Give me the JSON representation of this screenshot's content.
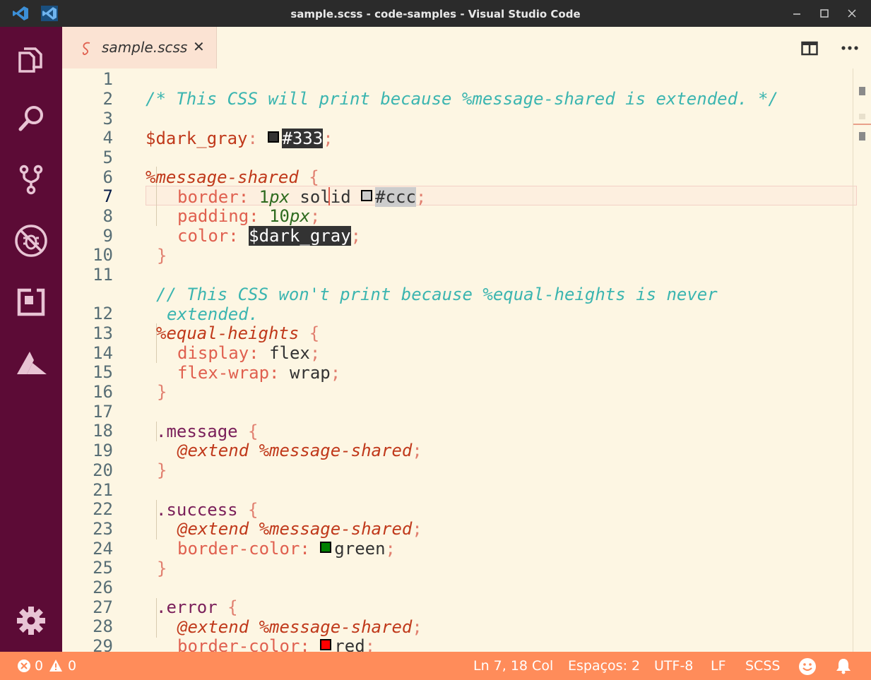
{
  "window": {
    "title": "sample.scss - code-samples - Visual Studio Code"
  },
  "activity_bar": {
    "items": [
      "explorer",
      "search",
      "source-control",
      "debug",
      "extensions",
      "azure"
    ],
    "settings": "gear"
  },
  "tabs": [
    {
      "label": "sample.scss",
      "active": true,
      "close": "✕"
    }
  ],
  "editor": {
    "lines": [
      {
        "n": "1"
      },
      {
        "n": "2"
      },
      {
        "n": "3"
      },
      {
        "n": "4"
      },
      {
        "n": "5"
      },
      {
        "n": "6"
      },
      {
        "n": "7"
      },
      {
        "n": "8"
      },
      {
        "n": "9"
      },
      {
        "n": "10"
      },
      {
        "n": "11"
      },
      {
        "n": "12"
      },
      {
        "n": "13"
      },
      {
        "n": "14"
      },
      {
        "n": "15"
      },
      {
        "n": "16"
      },
      {
        "n": "17"
      },
      {
        "n": "18"
      },
      {
        "n": "19"
      },
      {
        "n": "20"
      },
      {
        "n": "21"
      },
      {
        "n": "22"
      },
      {
        "n": "23"
      },
      {
        "n": "24"
      },
      {
        "n": "25"
      },
      {
        "n": "26"
      },
      {
        "n": "27"
      },
      {
        "n": "28"
      },
      {
        "n": "29"
      }
    ],
    "code": {
      "l1": "/* This CSS will print because %message-shared is extended. */",
      "l3_var": "$dark_gray",
      "l3_colon": ":",
      "l3_val": "#333",
      "l3_semi": ";",
      "l5_sel": "%message-shared",
      "brace_open": "{",
      "brace_close": "}",
      "l6_prop": "border",
      "colon": ":",
      "semi": ";",
      "l6_num": "1",
      "l6_unit": "px",
      "l6_solid": "solid",
      "l6_val": "#ccc",
      "l7_prop": "padding",
      "l7_num": "10",
      "l7_unit": "px",
      "l8_prop": "color",
      "l8_val": "$dark_gray",
      "l11a": "// This CSS won't print because %equal-heights is never",
      "l11b": "extended.",
      "l12_sel": "%equal-heights",
      "l13_prop": "display",
      "l13_val": "flex",
      "l14_prop": "flex-wrap",
      "l14_val": "wrap",
      "l17_sel": ".message",
      "extend": "@extend",
      "ph": "%message-shared",
      "l21_sel": ".success",
      "bc_prop": "border-color",
      "l23_val": "green",
      "l26_sel": ".error",
      "l28_val": "red"
    },
    "colors": {
      "dark_gray": "#333333",
      "ccc": "#cccccc",
      "green": "#008000",
      "red": "#ff0000"
    }
  },
  "status_bar": {
    "errors": "0",
    "warnings": "0",
    "position": "Ln 7, 18 Col",
    "indent": "Espaços: 2",
    "encoding": "UTF-8",
    "eol": "LF",
    "language": "SCSS"
  }
}
